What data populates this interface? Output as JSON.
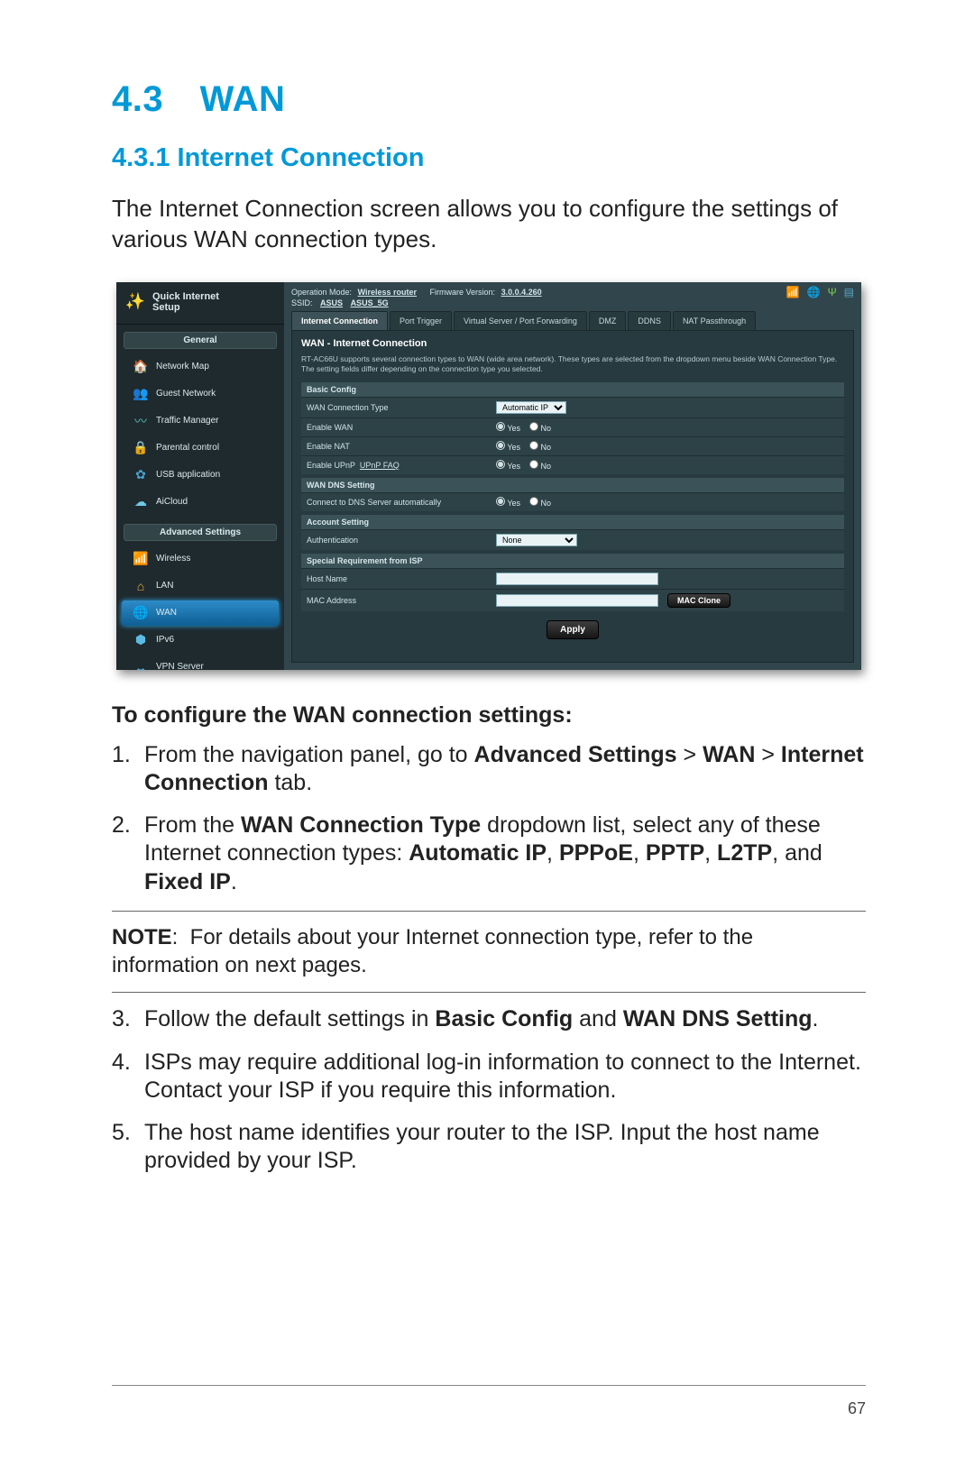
{
  "heading": "4.3 WAN",
  "subheading": "4.3.1 Internet Connection",
  "intro": "The Internet Connection screen allows you to configure the settings of various WAN connection types.",
  "screenshot": {
    "quick_internet_setup": "Quick Internet\nSetup",
    "side_general": "General",
    "side_advanced": "Advanced Settings",
    "general_items": [
      {
        "label": "Network Map",
        "icon": "🏠",
        "color": "#63c1e8"
      },
      {
        "label": "Guest Network",
        "icon": "👥",
        "color": "#4aa3d0"
      },
      {
        "label": "Traffic Manager",
        "icon": "〰",
        "color": "#57c1b8"
      },
      {
        "label": "Parental control",
        "icon": "🔒",
        "color": "#58c3e6"
      },
      {
        "label": "USB application",
        "icon": "✿",
        "color": "#4aa3d0"
      },
      {
        "label": "AiCloud",
        "icon": "☁",
        "color": "#6cc9e8"
      }
    ],
    "advanced_items": [
      {
        "label": "Wireless",
        "icon": "📶",
        "color": "#5cbbe4",
        "sel": false
      },
      {
        "label": "LAN",
        "icon": "⌂",
        "color": "#f2b13d",
        "sel": false
      },
      {
        "label": "WAN",
        "icon": "🌐",
        "color": "#6cc9e8",
        "sel": true
      },
      {
        "label": "IPv6",
        "icon": "⬢",
        "color": "#5cbbe4",
        "sel": false
      },
      {
        "label": "VPN Server",
        "icon": "↔",
        "color": "#5cbbe4",
        "sel": false
      }
    ],
    "top": {
      "op_mode_label": "Operation Mode:",
      "op_mode": "Wireless router",
      "fw_label": "Firmware Version:",
      "fw": "3.0.0.4.260",
      "ssid_label": "SSID:",
      "ssid1": "ASUS",
      "ssid2": "ASUS_5G",
      "icons": [
        {
          "name": "signal-icon",
          "glyph": "📶",
          "color": "#6fd24a"
        },
        {
          "name": "globe-icon",
          "glyph": "🌐",
          "color": "#5aa7c7"
        },
        {
          "name": "usb-icon",
          "glyph": "Ψ",
          "color": "#7ac84a"
        },
        {
          "name": "status-icon",
          "glyph": "▤",
          "color": "#5aa7c7"
        }
      ]
    },
    "tabs": [
      {
        "label": "Internet Connection",
        "active": true
      },
      {
        "label": "Port Trigger",
        "active": false
      },
      {
        "label": "Virtual Server / Port Forwarding",
        "active": false
      },
      {
        "label": "DMZ",
        "active": false
      },
      {
        "label": "DDNS",
        "active": false
      },
      {
        "label": "NAT Passthrough",
        "active": false
      }
    ],
    "panel_title": "WAN - Internet Connection",
    "panel_desc": "RT-AC66U supports several connection types to WAN (wide area network). These types are selected from the dropdown menu beside WAN Connection Type. The setting fields differ depending on the connection type you selected.",
    "sections": {
      "basic": {
        "title": "Basic Config",
        "rows": {
          "wan_type": {
            "label": "WAN Connection Type",
            "value": "Automatic IP"
          },
          "enable_wan": {
            "label": "Enable WAN",
            "yes": "Yes",
            "no": "No"
          },
          "enable_nat": {
            "label": "Enable NAT",
            "yes": "Yes",
            "no": "No"
          },
          "enable_upnp": {
            "label": "Enable UPnP",
            "faq": "UPnP FAQ",
            "yes": "Yes",
            "no": "No"
          }
        }
      },
      "dns": {
        "title": "WAN DNS Setting",
        "row": {
          "label": "Connect to DNS Server automatically",
          "yes": "Yes",
          "no": "No"
        }
      },
      "account": {
        "title": "Account Setting",
        "row": {
          "label": "Authentication",
          "value": "None"
        }
      },
      "isp": {
        "title": "Special Requirement from ISP",
        "host": {
          "label": "Host Name"
        },
        "mac": {
          "label": "MAC Address",
          "btn": "MAC Clone"
        }
      }
    },
    "apply": "Apply"
  },
  "configure_heading": "To configure the WAN connection settings:",
  "steps_first": [
    "From the navigation panel, go to <b>Advanced Settings</b> > <b>WAN</b> > <b>Internet Connection</b> tab.",
    "From the <b>WAN Connection Type</b> dropdown list, select any of these Internet connection types: <b>Automatic IP</b>, <b>PPPoE</b>, <b>PPTP</b>, <b>L2TP</b>, and <b>Fixed IP</b>."
  ],
  "note": "<b>NOTE</b>:  For details about your Internet connection type, refer to the information on next pages.",
  "steps_second": [
    "Follow the default settings in <b>Basic Config</b> and <b>WAN DNS Setting</b>.",
    "ISPs may require additional log-in information to connect to the Internet. Contact your ISP if you require this information.",
    "The host name identifies your router to the ISP. Input the host name provided by your ISP."
  ],
  "page_number": "67"
}
